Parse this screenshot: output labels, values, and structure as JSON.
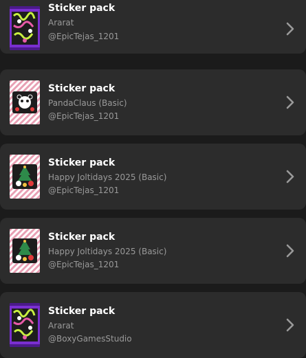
{
  "items": [
    {
      "title": "Sticker pack",
      "collection": "Ararat",
      "owner": "@EpicTejas_1201",
      "art": "purple-ararat-pack-icon"
    },
    {
      "title": "Sticker pack",
      "collection": "PandaClaus (Basic)",
      "owner": "@EpicTejas_1201",
      "art": "candy-stripe-panda-pack-icon"
    },
    {
      "title": "Sticker pack",
      "collection": "Happy Joltidays 2025 (Basic)",
      "owner": "@EpicTejas_1201",
      "art": "candy-stripe-joltidays-pack-icon"
    },
    {
      "title": "Sticker pack",
      "collection": "Happy Joltidays 2025 (Basic)",
      "owner": "@EpicTejas_1201",
      "art": "candy-stripe-joltidays-pack-icon"
    },
    {
      "title": "Sticker pack",
      "collection": "Ararat",
      "owner": "@BoxyGamesStudio",
      "art": "purple-ararat-pack-icon"
    }
  ],
  "colors": {
    "background": "#1b1b1b",
    "card": "#2c2c2c",
    "title": "#ffffff",
    "subtitle": "#9a9a9a",
    "chevron": "#9a9a9a"
  },
  "icons": {
    "chevron": "chevron-right-icon"
  }
}
